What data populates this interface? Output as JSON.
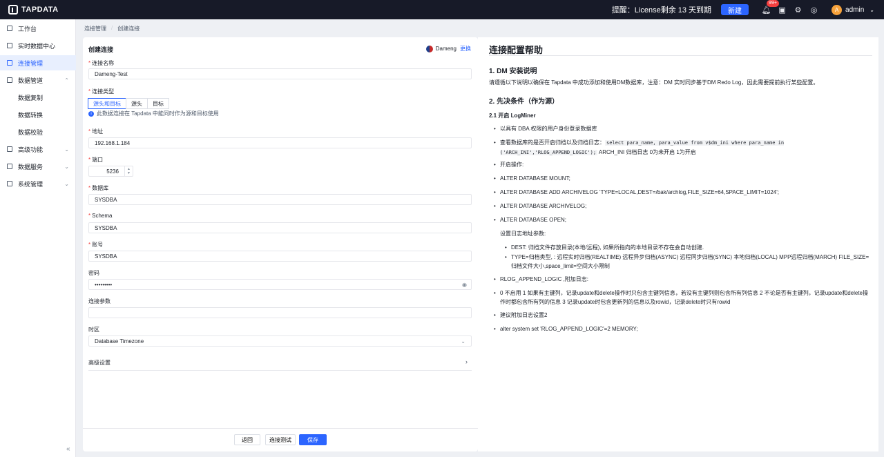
{
  "brand": {
    "name": "TAPDATA"
  },
  "topbar": {
    "reminder": "提醒：License剩余 13 天到期",
    "new_label": "新建",
    "notification_count": "99+",
    "user_initial": "A",
    "user_name": "admin"
  },
  "sidebar": {
    "items": [
      {
        "label": "工作台"
      },
      {
        "label": "实时数据中心"
      },
      {
        "label": "连接管理",
        "active": true
      },
      {
        "label": "数据管道"
      },
      {
        "label": "数据复制"
      },
      {
        "label": "数据转换"
      },
      {
        "label": "数据校验"
      },
      {
        "label": "高级功能"
      },
      {
        "label": "数据服务"
      },
      {
        "label": "系统管理"
      }
    ]
  },
  "breadcrumb": {
    "items": [
      "连接管理",
      "创建连接"
    ]
  },
  "form": {
    "title": "创建连接",
    "db_name": "Dameng",
    "change_label": "更换",
    "name_label": "连接名称",
    "name_value": "Dameng-Test",
    "type_label": "连接类型",
    "type_options": [
      "源头和目标",
      "源头",
      "目标"
    ],
    "type_hint": "此数据连接在 Tapdata 中能同时作为源和目标使用",
    "host_label": "地址",
    "host_value": "192.168.1.184",
    "port_label": "端口",
    "port_value": "5236",
    "database_label": "数据库",
    "database_value": "SYSDBA",
    "schema_label": "Schema",
    "schema_value": "SYSDBA",
    "account_label": "账号",
    "account_value": "SYSDBA",
    "password_label": "密码",
    "password_value": "•••••••••",
    "params_label": "连接参数",
    "params_value": "",
    "timezone_label": "时区",
    "timezone_value": "Database Timezone",
    "advanced_label": "高级设置",
    "back_label": "返回",
    "test_label": "连接测试",
    "save_label": "保存"
  },
  "help": {
    "title": "连接配置帮助",
    "s1_title": "1. DM 安装说明",
    "s1_text": "请遵循以下说明以确保在 Tapdata 中成功添加和使用DM数据库，注意：DM 实时同步基于DM Redo Log，因此需要提前执行某些配置。",
    "s2_title": "2. 先决条件（作为源）",
    "s21_title": "2.1 开启 LogMiner",
    "item1": "以具有 DBA 权限的用户身份登录数据库",
    "item2_a": "查看数据库的是否开启归档以及归档日志：",
    "item2_code": "select para_name, para_value from v$dm_ini where para_name in ('ARCH_INI','RLOG_APPEND_LOGIC');",
    "item2_b": " ARCH_INI 归档日志 0为未开启 1为开启",
    "item3": "开启操作:",
    "item4": "ALTER DATABASE MOUNT;",
    "item5": "ALTER DATABASE ADD ARCHIVELOG 'TYPE=LOCAL,DEST=/bak/archlog,FILE_SIZE=64,SPACE_LIMIT=1024';",
    "item6": "ALTER DATABASE ARCHIVELOG;",
    "item7": "ALTER DATABASE OPEN;",
    "item8": "设置日志地址参数:",
    "sub1": "DEST: 归档文件存放目录(本地/远程), 如果所指向的本地目录不存在会自动创建.",
    "sub2": "TYPE=归档类型, : 远程实时归档(REALTIME) 远程异步归档(ASYNC) 远程同步归档(SYNC) 本地归档(LOCAL) MPP远程归档(MARCH) FILE_SIZE=归档文件大小,space_limit=空间大小限制",
    "item9": "RLOG_APPEND_LOGIC ,附加日志:",
    "item10": "0 不启用 1 如果有主键列，记录update和delete操作时只包含主键列信息，若没有主键列则包含所有列信息 2 不论是否有主键列，记录update和delete操作时都包含所有列的信息 3 记录update时包含更新列的信息以及rowid，记录delete时只有rowid",
    "item11": "建议附加日志设置2",
    "item12": "alter system set 'RLOG_APPEND_LOGIC'=2 MEMORY;"
  }
}
